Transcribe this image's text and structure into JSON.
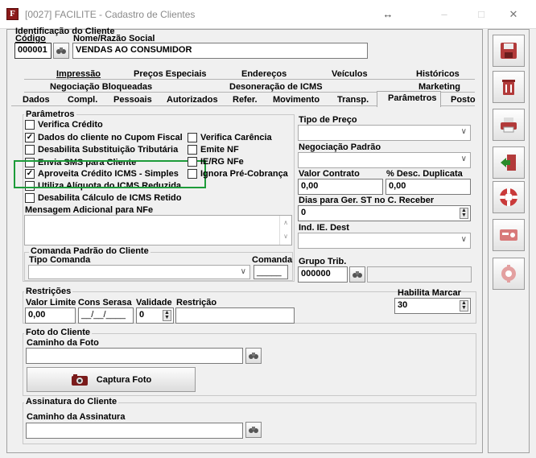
{
  "window": {
    "title": "[0027] FACILITE - Cadastro de Clientes",
    "app_icon_letter": "F",
    "move_glyph": "↔",
    "minimize_glyph": "–",
    "maximize_glyph": "□",
    "close_glyph": "✕"
  },
  "identificacao": {
    "title": "Identificação do Cliente",
    "codigo_label": "Código",
    "codigo_value": "000001",
    "nome_label": "Nome/Razão Social",
    "nome_value": "VENDAS AO CONSUMIDOR"
  },
  "tabs": {
    "row1": [
      "Impressão",
      "Preços Especiais",
      "Endereços",
      "Veículos",
      "Históricos"
    ],
    "row2": [
      "Negociação Bloqueadas",
      "Desoneração de ICMS",
      "Marketing"
    ],
    "row3": [
      "Dados",
      "Compl.",
      "Pessoais",
      "Autorizados",
      "Refer.",
      "Movimento",
      "Transp.",
      "Parâmetros",
      "Posto"
    ],
    "active": "Parâmetros"
  },
  "parametros": {
    "title": "Parâmetros",
    "checkboxes_left": [
      {
        "label": "Verifica Crédito",
        "checked": false
      },
      {
        "label": "Dados do cliente no Cupom Fiscal",
        "checked": true
      },
      {
        "label": "Desabilita Substituição Tributária",
        "checked": false
      },
      {
        "label": "Envia SMS para Cliente",
        "checked": false
      },
      {
        "label": "Aproveita Crédito ICMS - Simples",
        "checked": true
      },
      {
        "label": "Utiliza Alíquota do ICMS Reduzida",
        "checked": false
      },
      {
        "label": "Desabilita Cálculo de ICMS Retido",
        "checked": false
      }
    ],
    "checkboxes_right": [
      {
        "label": "Verifica Carência",
        "checked": false
      },
      {
        "label": "Emite NF",
        "checked": false
      },
      {
        "label": "IE/RG NFe",
        "checked": false
      },
      {
        "label": "Ignora Pré-Cobrança",
        "checked": false
      }
    ],
    "mensagem_label": "Mensagem Adicional para NFe",
    "mensagem_value": "",
    "comanda_title": "Comanda Padrão do Cliente",
    "tipo_comanda_label": "Tipo Comanda",
    "tipo_comanda_value": "",
    "comanda_label": "Comanda",
    "comanda_value": "_____",
    "tipo_preco_label": "Tipo de Preço",
    "tipo_preco_value": "",
    "negociacao_label": "Negociação Padrão",
    "negociacao_value": "",
    "valor_contrato_label": "Valor Contrato",
    "valor_contrato_value": "0,00",
    "desc_duplicata_label": "% Desc. Duplicata",
    "desc_duplicata_value": "0,00",
    "dias_st_label": "Dias para Ger. ST no C. Receber",
    "dias_st_value": "0",
    "ind_ie_label": "Ind. IE. Dest",
    "ind_ie_value": "",
    "grupo_trib_label": "Grupo Trib.",
    "grupo_trib_value": "000000",
    "grupo_trib_desc": ""
  },
  "restricoes": {
    "title": "Restrições",
    "valor_limite_label": "Valor Limite",
    "valor_limite_value": "0,00",
    "cons_serasa_label": "Cons Serasa",
    "cons_serasa_value": "__/__/____",
    "validade_label": "Validade",
    "validade_value": "0",
    "restricao_label": "Restrição",
    "restricao_value": "",
    "habilita_label": "Habilita Marcar",
    "habilita_value": "30"
  },
  "foto": {
    "title": "Foto do Cliente",
    "caminho_label": "Caminho da Foto",
    "caminho_value": "",
    "captura_label": "Captura Foto"
  },
  "assinatura": {
    "title": "Assinatura do Cliente",
    "caminho_label": "Caminho da Assinatura",
    "caminho_value": ""
  },
  "colors": {
    "highlight": "#1d9c3a",
    "app_icon": "#8b1a1a"
  },
  "sidebar_icons": [
    "save-icon",
    "delete-icon",
    "print-icon",
    "exit-icon",
    "help-icon",
    "registry-icon",
    "settings-icon"
  ]
}
